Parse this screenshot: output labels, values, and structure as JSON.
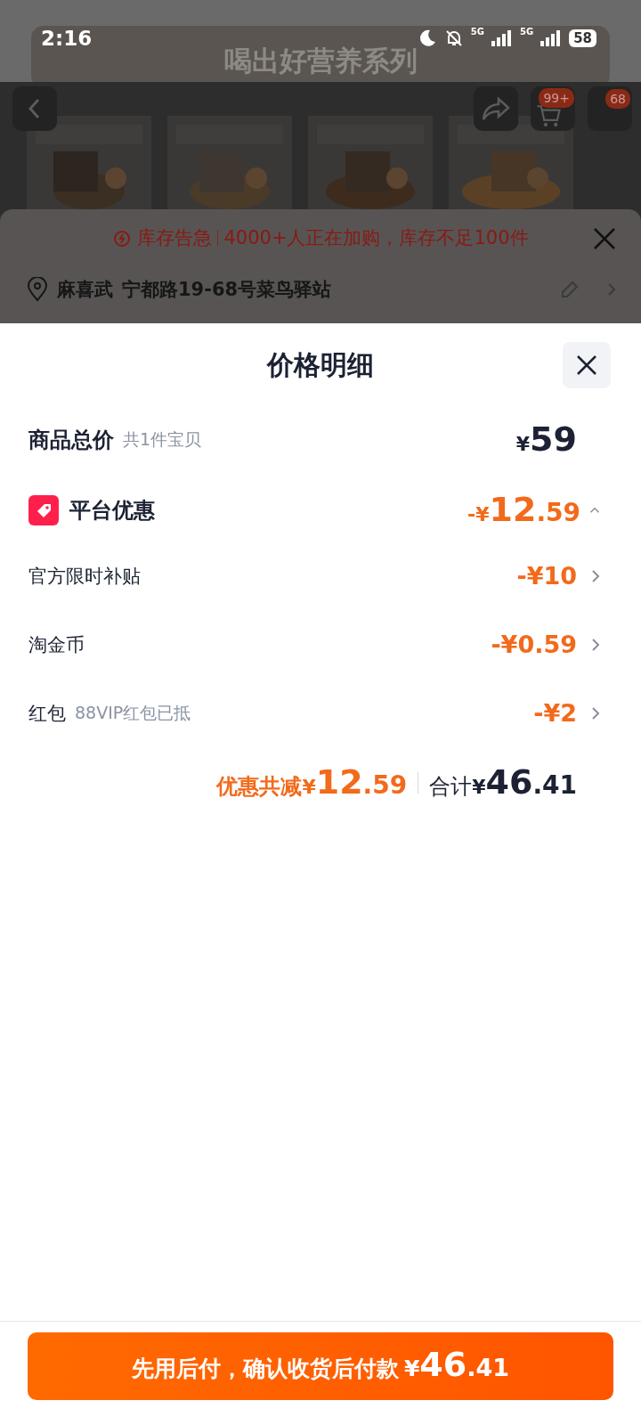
{
  "status_bar": {
    "time": "2:16",
    "network_1": "5G",
    "network_2": "5G",
    "battery": "58"
  },
  "banner": {
    "title": "喝出好营养系列"
  },
  "nav": {
    "cart_badge": "99+",
    "messages_badge": "68"
  },
  "stock_alert": {
    "label": "库存告急",
    "message": "4000+人正在加购，库存不足100件"
  },
  "address": {
    "name": "麻喜武",
    "detail": "宁都路19-68号菜鸟驿站"
  },
  "price_sheet": {
    "title": "价格明细",
    "total": {
      "label": "商品总价",
      "note": "共1件宝贝",
      "symbol": "¥",
      "main": "59"
    },
    "platform_discount": {
      "label": "平台优惠",
      "symbol": "-¥",
      "main": "12",
      "fraction": ".59",
      "expanded": true
    },
    "items": [
      {
        "label": "官方限时补贴",
        "value": "-¥10"
      },
      {
        "label": "淘金币",
        "value": "-¥0.59"
      },
      {
        "label": "红包",
        "note": "88VIP红包已抵",
        "value": "-¥2"
      }
    ],
    "summary": {
      "discount_label": "优惠共减",
      "discount_symbol": "¥",
      "discount_main": "12",
      "discount_fraction": ".59",
      "total_label": "合计",
      "total_symbol": "¥",
      "total_main": "46",
      "total_fraction": ".41"
    }
  },
  "pay_button": {
    "label": "先用后付，确认收货后付款",
    "symbol": "¥",
    "main": "46",
    "fraction": ".41"
  }
}
